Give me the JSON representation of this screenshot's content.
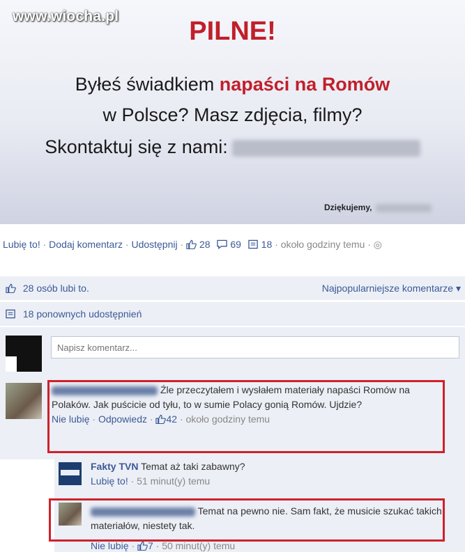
{
  "watermark": "www.wiocha.pl",
  "banner": {
    "headline": "PILNE!",
    "line1_a": "Byłeś świadkiem ",
    "line1_b": "napaści na Romów",
    "line2": "w Polsce? Masz zdjęcia, filmy?",
    "line3": "Skontaktuj się z nami:",
    "thanks": "Dziękujemy,"
  },
  "actions": {
    "like": "Lubię to!",
    "comment": "Dodaj komentarz",
    "share": "Udostępnij",
    "likes_count": "28",
    "comments_count": "69",
    "shares_count": "18",
    "time": "około godziny temu"
  },
  "likes_row": {
    "text": "28 osób lubi to.",
    "sort": "Najpopularniejsze komentarze ▾"
  },
  "shares_row": {
    "text": "18 ponownych udostępnień"
  },
  "composer": {
    "placeholder": "Napisz komentarz..."
  },
  "comments": [
    {
      "text": "Źle przeczytałem i wysłałem materiały napaści Romów na Polaków. Jak puścicie od tyłu, to w sumie Polacy gonią Romów. Ujdzie?",
      "unlike": "Nie lubię",
      "reply": "Odpowiedz",
      "likes": "42",
      "time": "około godziny temu",
      "replies": [
        {
          "author": "Fakty TVN",
          "text": "Temat aż taki zabawny?",
          "like": "Lubię to!",
          "time": "51 minut(y) temu"
        },
        {
          "text": "Temat na pewno nie. Sam fakt, że musicie szukać takich materiałów, niestety tak.",
          "unlike": "Nie lubię",
          "likes": "7",
          "time": "50 minut(y) temu"
        }
      ]
    }
  ],
  "colors": {
    "fb_blue": "#3b5998",
    "highlight_red": "#d0202b",
    "panel_bg": "#eceff5"
  }
}
